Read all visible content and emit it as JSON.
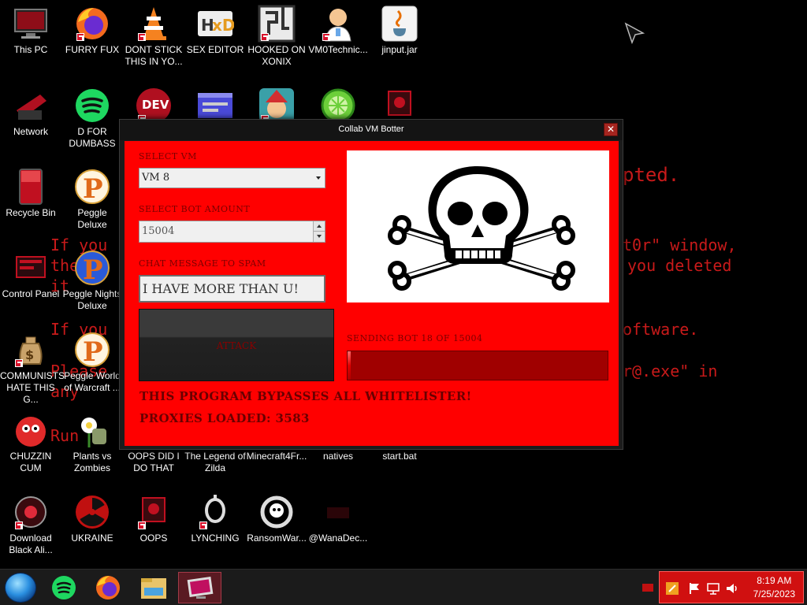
{
  "background_text": [
    "pted.",
    "If you",
    "the",
    "it",
    "t0r\" window,",
    "you deleted",
    "If you",
    "oftware.",
    "Please",
    "any",
    "r@.exe\" in",
    "Run"
  ],
  "desktop": {
    "icons": [
      {
        "label": "This PC",
        "icon": "monitor-icon"
      },
      {
        "label": "FURRY FUX",
        "icon": "firefox-icon"
      },
      {
        "label": "DONT STICK THIS IN YO...",
        "icon": "vlc-cone-icon"
      },
      {
        "label": "SEX EDITOR",
        "icon": "hxd-icon"
      },
      {
        "label": "HOOKED ON XONIX",
        "icon": "maze-icon"
      },
      {
        "label": "VM0Technic...",
        "icon": "doctor-icon"
      },
      {
        "label": "jinput.jar",
        "icon": "java-icon"
      },
      {
        "label": "Network",
        "icon": "network-icon"
      },
      {
        "label": "D FOR DUMBASS",
        "icon": "spotify-icon"
      },
      {
        "label": "",
        "icon": "devcpp-icon"
      },
      {
        "label": "",
        "icon": "window-app-icon"
      },
      {
        "label": "",
        "icon": "gnome-icon"
      },
      {
        "label": "",
        "icon": "lime-icon"
      },
      {
        "label": "",
        "icon": "red-app-icon"
      },
      {
        "label": "Recycle Bin",
        "icon": "recycle-bin-icon"
      },
      {
        "label": "Peggle Deluxe",
        "icon": "peggle-icon"
      },
      {
        "label": "Control Panel",
        "icon": "control-panel-icon"
      },
      {
        "label": "Peggle Nights Deluxe",
        "icon": "peggle-nights-icon"
      },
      {
        "label": "COMMUNISTS HATE THIS G...",
        "icon": "money-bag-icon"
      },
      {
        "label": "Peggle World of Warcraft ...",
        "icon": "peggle-wow-icon"
      },
      {
        "label": "CHUZZIN CUM",
        "icon": "chuzzle-icon"
      },
      {
        "label": "Plants vs Zombies",
        "icon": "pvz-icon"
      },
      {
        "label": "OOPS DID I DO THAT",
        "icon": "red-app-icon"
      },
      {
        "label": "The Legend of Zilda",
        "icon": "blank-icon"
      },
      {
        "label": "Minecraft4Fr...",
        "icon": "blank-icon"
      },
      {
        "label": "natives",
        "icon": "blank-icon"
      },
      {
        "label": "start.bat",
        "icon": "blank-icon"
      },
      {
        "label": "Download Black Ali...",
        "icon": "black-ali-icon"
      },
      {
        "label": "UKRAINE",
        "icon": "radiation-icon"
      },
      {
        "label": "OOPS",
        "icon": "red-app-icon"
      },
      {
        "label": "LYNCHING",
        "icon": "noose-icon"
      },
      {
        "label": "RansomWar...",
        "icon": "skull-ring-icon"
      },
      {
        "label": "@WanaDec...",
        "icon": "wana-icon"
      }
    ]
  },
  "window": {
    "title": "Collab VM Botter",
    "close_glyph": "✕",
    "select_vm_label": "SELECT VM",
    "vm_value": "VM 8",
    "bot_amount_label": "SELECT BOT AMOUNT",
    "bot_amount_value": "15004",
    "chat_label": "CHAT MESSAGE TO SPAM",
    "chat_value": "I HAVE MORE THAN U!",
    "attack_label": "ATTACK",
    "progress_label": "SENDING BOT 18 OF 15004",
    "progress_fraction": 0.0012,
    "bypass_text": "THIS PROGRAM BYPASSES ALL WHITELISTER!",
    "proxies_text": "PROXIES LOADED: 3583"
  },
  "taskbar": {
    "items": [
      {
        "icon": "spotify-icon"
      },
      {
        "icon": "firefox-icon"
      },
      {
        "icon": "file-explorer-icon"
      },
      {
        "icon": "bad-monitor-icon"
      }
    ],
    "clock_time": "8:19 AM",
    "clock_date": "7/25/2023"
  },
  "colors": {
    "client_bg": "#ff0000",
    "label_red": "#7a0000",
    "background_text": "#c81a1a"
  }
}
